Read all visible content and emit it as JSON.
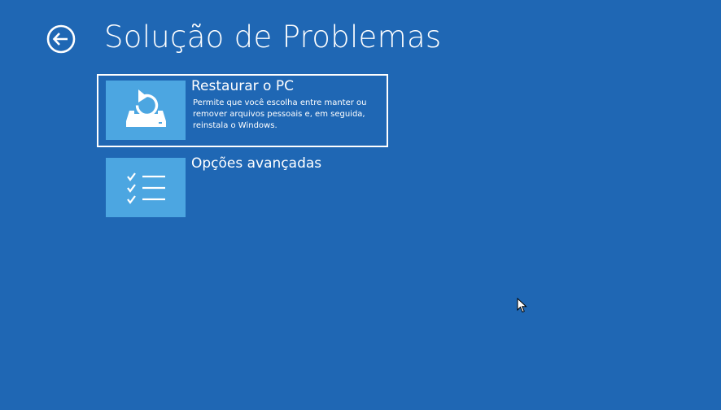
{
  "header": {
    "title": "Solução de Problemas"
  },
  "tiles": [
    {
      "title": "Restaurar o PC",
      "description": "Permite que você escolha entre manter ou remover arquivos pessoais e, em seguida, reinstala o Windows.",
      "icon": "reset-pc-icon",
      "selected": true
    },
    {
      "title": "Opções avançadas",
      "description": "",
      "icon": "checklist-icon",
      "selected": false
    }
  ],
  "colors": {
    "background": "#1f67b4",
    "tile_icon": "#4ca6e1",
    "text": "#ffffff"
  }
}
